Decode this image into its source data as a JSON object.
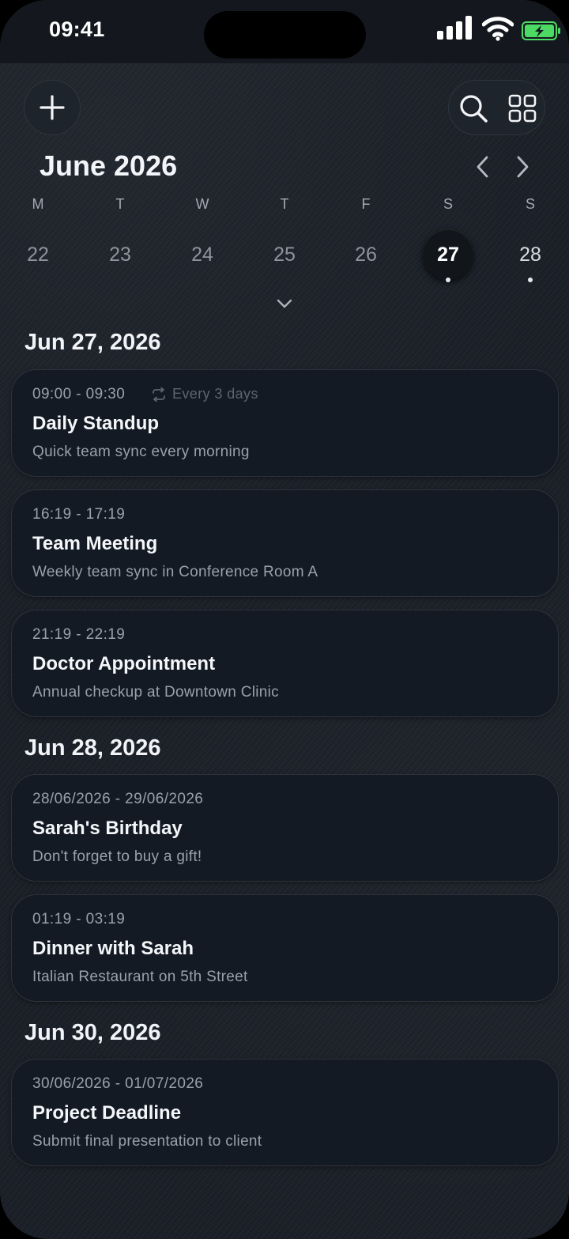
{
  "status_bar": {
    "time": "09:41"
  },
  "calendar": {
    "month_title": "June 2026",
    "weekdays": [
      "M",
      "T",
      "W",
      "T",
      "F",
      "S",
      "S"
    ],
    "dates": [
      "22",
      "23",
      "24",
      "25",
      "26",
      "27",
      "28"
    ],
    "selected_date": "27"
  },
  "icons": {
    "add": "plus-icon",
    "search": "search-icon",
    "grid": "grid-icon",
    "prev": "chevron-left-icon",
    "next": "chevron-right-icon",
    "expand": "chevron-down-icon",
    "repeat": "repeat-icon"
  },
  "sections": [
    {
      "heading": "Jun 27, 2026",
      "events": [
        {
          "time": "09:00 - 09:30",
          "repeat": "Every 3 days",
          "title": "Daily Standup",
          "desc": "Quick team sync every morning"
        },
        {
          "time": "16:19 - 17:19",
          "title": "Team Meeting",
          "desc": "Weekly team sync in Conference Room A"
        },
        {
          "time": "21:19 - 22:19",
          "title": "Doctor Appointment",
          "desc": "Annual checkup at Downtown Clinic"
        }
      ]
    },
    {
      "heading": "Jun 28, 2026",
      "events": [
        {
          "time": "28/06/2026 - 29/06/2026",
          "title": "Sarah's Birthday",
          "desc": "Don't forget to buy a gift!"
        },
        {
          "time": "01:19 - 03:19",
          "title": "Dinner with Sarah",
          "desc": "Italian Restaurant on 5th Street"
        }
      ]
    },
    {
      "heading": "Jun 30, 2026",
      "events": [
        {
          "time": "30/06/2026 - 01/07/2026",
          "title": "Project Deadline",
          "desc": "Submit final presentation to client"
        }
      ]
    }
  ]
}
